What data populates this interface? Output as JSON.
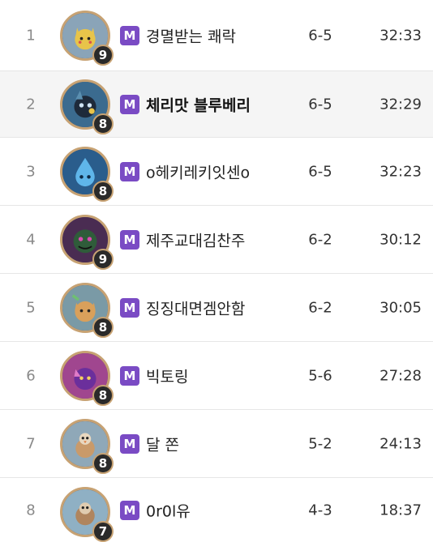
{
  "colors": {
    "tier_badge": "#7a4bc4",
    "avatar_border": "#c7a273",
    "level_badge": "#2a2a2a",
    "highlight_row": "#f5f5f5"
  },
  "rows": [
    {
      "rank": "1",
      "tier": "M",
      "name": "경멸받는 쾌락",
      "level": "9",
      "stage": "6-5",
      "time": "32:33",
      "avatar_icon": "pikachu-avatar-icon",
      "avatar_color": "#8aa4b8",
      "avatar_accent": "#e8c44a"
    },
    {
      "rank": "2",
      "tier": "M",
      "name": "체리맛 블루베리",
      "level": "8",
      "stage": "6-5",
      "time": "32:29",
      "avatar_icon": "dark-creature-avatar-icon",
      "avatar_color": "#3b6b8f",
      "avatar_accent": "#1e2a3a"
    },
    {
      "rank": "3",
      "tier": "M",
      "name": "o헤키레키잇센o",
      "level": "8",
      "stage": "6-5",
      "time": "32:23",
      "avatar_icon": "water-drop-avatar-icon",
      "avatar_color": "#2a5d8c",
      "avatar_accent": "#5fb6ea"
    },
    {
      "rank": "4",
      "tier": "M",
      "name": "제주교대김찬주",
      "level": "9",
      "stage": "6-2",
      "time": "30:12",
      "avatar_icon": "shadow-creature-avatar-icon",
      "avatar_color": "#4a2c52",
      "avatar_accent": "#2f5c3a"
    },
    {
      "rank": "5",
      "tier": "M",
      "name": "징징대면겜안함",
      "level": "8",
      "stage": "6-2",
      "time": "30:05",
      "avatar_icon": "fox-creature-avatar-icon",
      "avatar_color": "#7a9aa6",
      "avatar_accent": "#d9a05b"
    },
    {
      "rank": "6",
      "tier": "M",
      "name": "빅토링",
      "level": "8",
      "stage": "5-6",
      "time": "27:28",
      "avatar_icon": "purple-creature-avatar-icon",
      "avatar_color": "#a0468f",
      "avatar_accent": "#6b2f9c"
    },
    {
      "rank": "7",
      "tier": "M",
      "name": "달 쫀",
      "level": "8",
      "stage": "5-2",
      "time": "24:13",
      "avatar_icon": "bird-creature-avatar-icon",
      "avatar_color": "#8fa8b8",
      "avatar_accent": "#c99a6a"
    },
    {
      "rank": "8",
      "tier": "M",
      "name": "0r0l유",
      "level": "7",
      "stage": "4-3",
      "time": "18:37",
      "avatar_icon": "small-creature-avatar-icon",
      "avatar_color": "#8fb0c4",
      "avatar_accent": "#b0855e"
    }
  ]
}
